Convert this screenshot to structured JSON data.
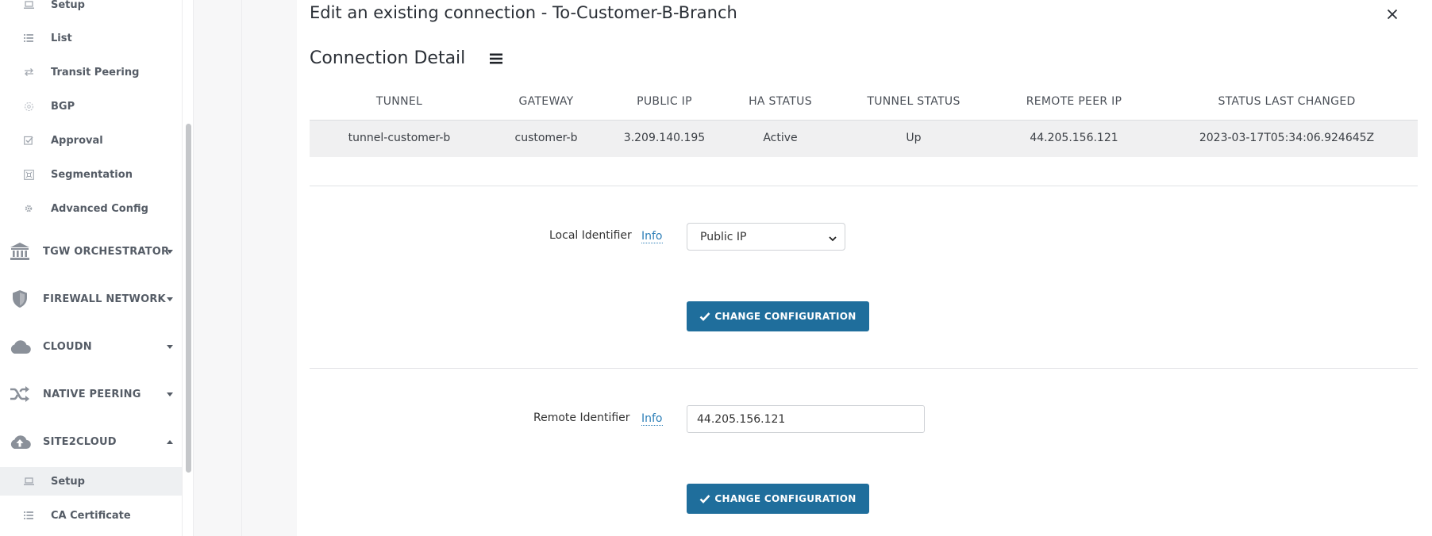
{
  "sidebar": {
    "sub_items_top": [
      {
        "label": "Setup",
        "icon": "laptop-icon",
        "active": false
      },
      {
        "label": "List",
        "icon": "list-icon",
        "active": false
      },
      {
        "label": "Transit Peering",
        "icon": "transfer-icon",
        "active": false
      },
      {
        "label": "BGP",
        "icon": "bgp-icon",
        "active": false
      },
      {
        "label": "Approval",
        "icon": "check-square-icon",
        "active": false
      },
      {
        "label": "Segmentation",
        "icon": "segmentation-icon",
        "active": false
      },
      {
        "label": "Advanced Config",
        "icon": "gear-icon",
        "active": false
      }
    ],
    "main_items": [
      {
        "label": "TGW ORCHESTRATOR",
        "icon": "bank-icon",
        "expanded": false
      },
      {
        "label": "FIREWALL NETWORK",
        "icon": "shield-icon",
        "expanded": false
      },
      {
        "label": "CLOUDN",
        "icon": "cloud-icon",
        "expanded": false
      },
      {
        "label": "NATIVE PEERING",
        "icon": "shuffle-icon",
        "expanded": false
      },
      {
        "label": "SITE2CLOUD",
        "icon": "cloud-upload-icon",
        "expanded": true
      }
    ],
    "sub_items_bottom": [
      {
        "label": "Setup",
        "icon": "laptop-icon",
        "active": true
      },
      {
        "label": "CA Certificate",
        "icon": "list-icon",
        "active": false
      }
    ]
  },
  "dialog": {
    "title": "Edit an existing connection - To-Customer-B-Branch",
    "section_title": "Connection Detail"
  },
  "table": {
    "headers": [
      "TUNNEL",
      "GATEWAY",
      "PUBLIC IP",
      "HA STATUS",
      "TUNNEL STATUS",
      "REMOTE PEER IP",
      "STATUS LAST CHANGED"
    ],
    "rows": [
      [
        "tunnel-customer-b",
        "customer-b",
        "3.209.140.195",
        "Active",
        "Up",
        "44.205.156.121",
        "2023-03-17T05:34:06.924645Z"
      ]
    ]
  },
  "local_identifier": {
    "label": "Local Identifier",
    "info": "Info",
    "selected": "Public IP",
    "button": "CHANGE CONFIGURATION"
  },
  "remote_identifier": {
    "label": "Remote Identifier",
    "info": "Info",
    "value": "44.205.156.121",
    "button": "CHANGE CONFIGURATION"
  },
  "colors": {
    "button": "#1f6e9c",
    "link": "#2d7fb8",
    "row_bg": "#f0f0f1"
  }
}
